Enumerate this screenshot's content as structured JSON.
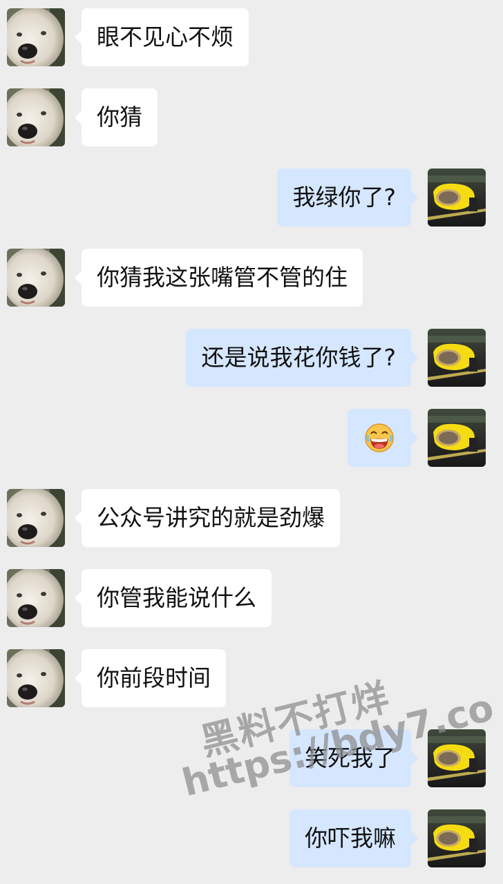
{
  "messages": [
    {
      "side": "left",
      "text": "眼不见心不烦"
    },
    {
      "side": "left",
      "text": "你猜"
    },
    {
      "side": "right",
      "text": "我绿你了?"
    },
    {
      "side": "left",
      "text": "你猜我这张嘴管不管的住"
    },
    {
      "side": "right",
      "text": "还是说我花你钱了?"
    },
    {
      "side": "right",
      "emoji": "laughing-face-emoji"
    },
    {
      "side": "left",
      "text": "公众号讲究的就是劲爆"
    },
    {
      "side": "left",
      "text": "你管我能说什么"
    },
    {
      "side": "left",
      "text": "你前段时间"
    },
    {
      "side": "right",
      "text": "笑死我了"
    },
    {
      "side": "right",
      "text": "你吓我嘛"
    }
  ],
  "avatars": {
    "left": "dog-avatar",
    "right": "yellow-car-mirror-avatar"
  },
  "watermark": {
    "line1": "黑料不打烊",
    "line2": "https://bdy7.co"
  },
  "colors": {
    "background": "#ededed",
    "incoming_bubble": "#ffffff",
    "outgoing_bubble": "#d5e6ff"
  }
}
